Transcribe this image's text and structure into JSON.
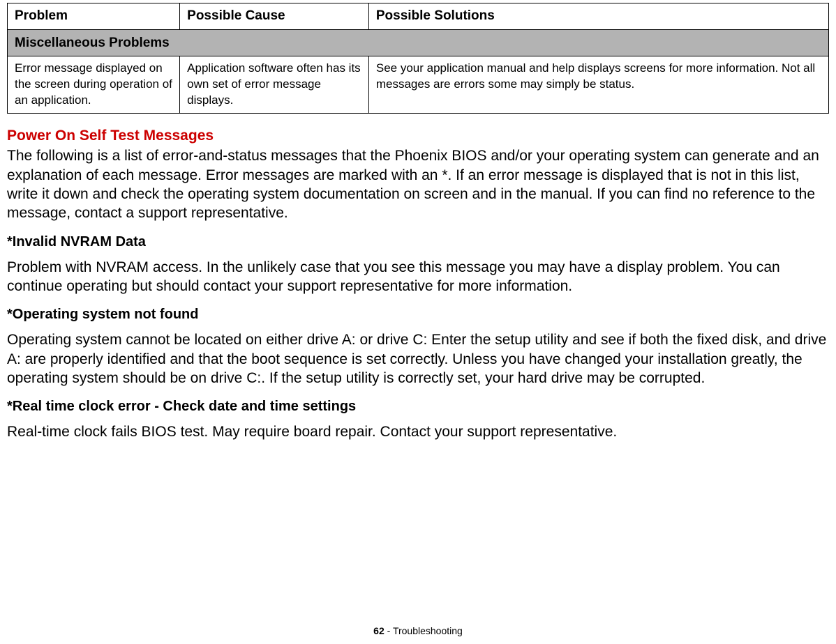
{
  "table": {
    "headers": [
      "Problem",
      "Possible Cause",
      "Possible Solutions"
    ],
    "section_header": "Miscellaneous Problems",
    "row": {
      "problem": "Error message displayed on the screen during operation of an application.",
      "cause": "Application software often has its own set of error message displays.",
      "solution": "See your application manual and help displays screens for more information. Not all messages are errors some may simply be status."
    }
  },
  "heading": "Power On Self Test Messages",
  "intro": "The following is a list of error-and-status messages that the Phoenix BIOS and/or your operating system can generate and an explanation of each message. Error messages are marked with an *. If an error message is displayed that is not in this list, write it down and check the operating system documentation on screen and in the manual. If you can find no reference to the message, contact a support representative.",
  "msg1": {
    "title": "*Invalid NVRAM Data",
    "body": "Problem with NVRAM access. In the unlikely case that you see this message you may have a display problem. You can continue operating but should contact your support representative for more information."
  },
  "msg2": {
    "title": "*Operating system not found",
    "body": "Operating system cannot be located on either drive A: or drive C: Enter the setup utility and see if both the fixed disk, and drive A: are properly identified and that the boot sequence is set correctly. Unless you have changed your installation greatly, the operating system should be on drive C:. If the setup utility is correctly set, your hard drive may be corrupted."
  },
  "msg3": {
    "title": "*Real time clock error - Check date and time settings",
    "body": "Real-time clock fails BIOS test. May require board repair. Contact your support representative."
  },
  "footer": {
    "page": "62",
    "section": " - Troubleshooting"
  }
}
